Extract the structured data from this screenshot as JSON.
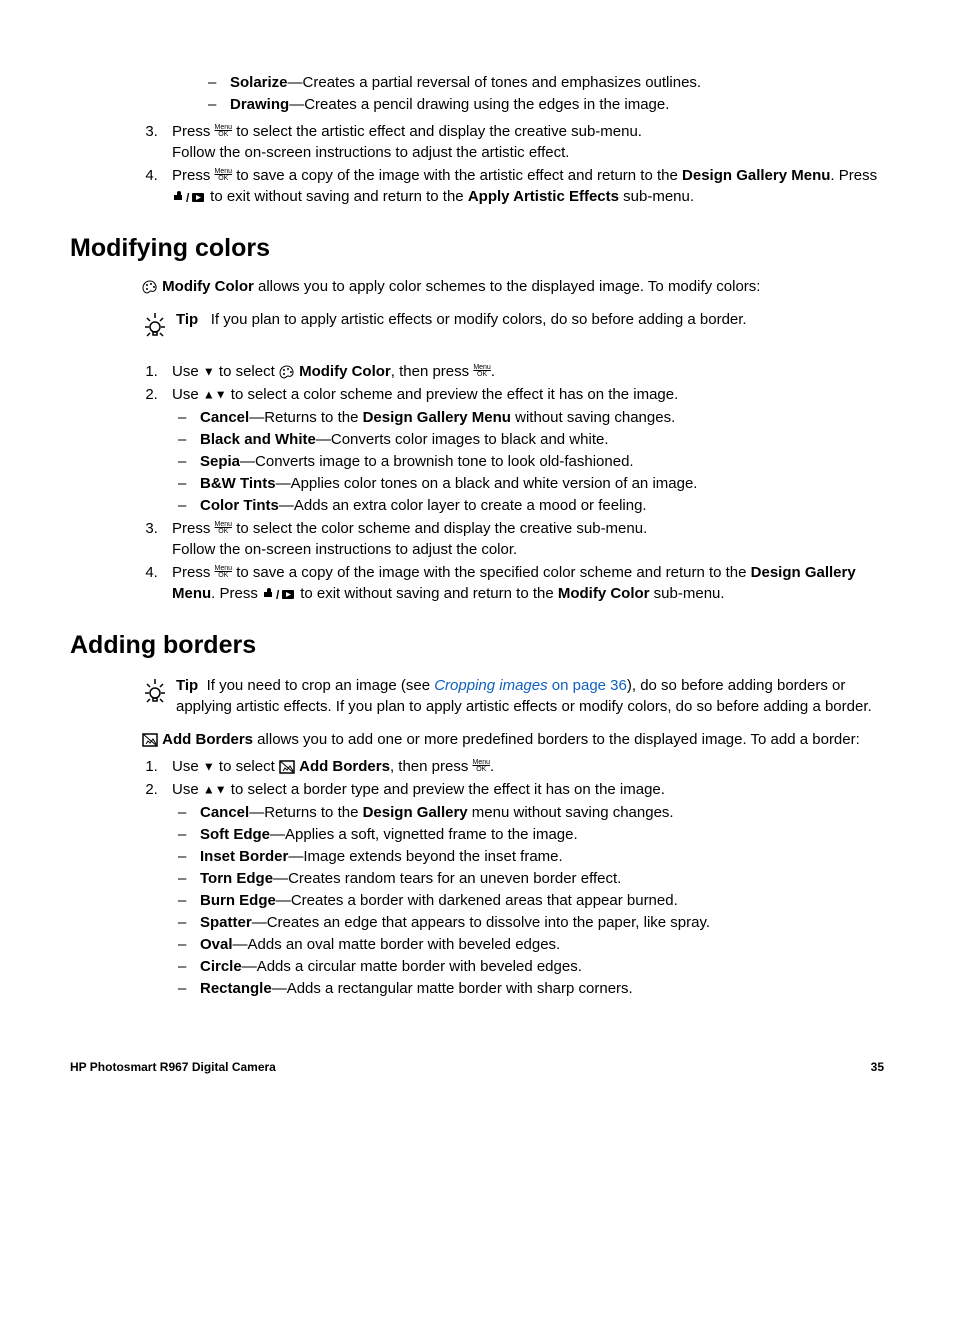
{
  "top_list": {
    "sub_items": [
      {
        "name": "Solarize",
        "desc": "—Creates a partial reversal of tones and emphasizes outlines."
      },
      {
        "name": "Drawing",
        "desc": "—Creates a pencil drawing using the edges in the image."
      }
    ],
    "step3a": "Press ",
    "step3b": " to select the artistic effect and display the creative sub-menu.",
    "step3c": "Follow the on-screen instructions to adjust the artistic effect.",
    "step4a": "Press ",
    "step4b": " to save a copy of the image with the artistic effect and return to the ",
    "step4_design": "Design Gallery Menu",
    "step4c": ". Press ",
    "step4d": " to exit without saving and return to the ",
    "step4_apply": "Apply Artistic Effects",
    "step4e": " sub-menu."
  },
  "modifying_colors": {
    "heading": "Modifying colors",
    "intro_bold": "Modify Color",
    "intro_rest": " allows you to apply color schemes to the displayed image. To modify colors:",
    "tip_label": "Tip",
    "tip_text": "If you plan to apply artistic effects or modify colors, do so before adding a border.",
    "step1a": "Use ",
    "step1b": " to select ",
    "step1_bold": "Modify Color",
    "step1c": ", then press ",
    "step1d": ".",
    "step2": "Use ",
    "step2b": " to select a color scheme and preview the effect it has on the image.",
    "schemes": [
      {
        "name": "Cancel",
        "desc_a": "—Returns to the ",
        "desc_bold": "Design Gallery Menu",
        "desc_b": " without saving changes."
      },
      {
        "name": "Black and White",
        "desc_a": "—Converts color images to black and white.",
        "desc_bold": "",
        "desc_b": ""
      },
      {
        "name": "Sepia",
        "desc_a": "—Converts image to a brownish tone to look old-fashioned.",
        "desc_bold": "",
        "desc_b": ""
      },
      {
        "name": "B&W Tints",
        "desc_a": "—Applies color tones on a black and white version of an image.",
        "desc_bold": "",
        "desc_b": ""
      },
      {
        "name": "Color Tints",
        "desc_a": "—Adds an extra color layer to create a mood or feeling.",
        "desc_bold": "",
        "desc_b": ""
      }
    ],
    "step3a": "Press ",
    "step3b": " to select the color scheme and display the creative sub-menu.",
    "step3c": "Follow the on-screen instructions to adjust the color.",
    "step4a": "Press ",
    "step4b": " to save a copy of the image with the specified color scheme and return to the ",
    "step4_design": "Design Gallery Menu",
    "step4c": ". Press ",
    "step4d": " to exit without saving and return to the ",
    "step4_modify": "Modify Color",
    "step4e": " sub-menu."
  },
  "adding_borders": {
    "heading": "Adding borders",
    "tip_label": "Tip",
    "tip_a": "If you need to crop an image (see ",
    "tip_link": "Cropping images",
    "tip_link2": " on page 36",
    "tip_b": "), do so before adding borders or applying artistic effects. If you plan to apply artistic effects or modify colors, do so before adding a border.",
    "intro_bold": "Add Borders",
    "intro_rest": " allows you to add one or more predefined borders to the displayed image. To add a border:",
    "step1a": "Use ",
    "step1b": " to select ",
    "step1_bold": "Add Borders",
    "step1c": ", then press ",
    "step1d": ".",
    "step2a": "Use ",
    "step2b": " to select a border type and preview the effect it has on the image.",
    "borders": [
      {
        "name": "Cancel",
        "desc_a": "—Returns to the ",
        "desc_bold": "Design Gallery",
        "desc_b": " menu without saving changes."
      },
      {
        "name": "Soft Edge",
        "desc_a": "—Applies a soft, vignetted frame to the image.",
        "desc_bold": "",
        "desc_b": ""
      },
      {
        "name": "Inset Border",
        "desc_a": "—Image extends beyond the inset frame.",
        "desc_bold": "",
        "desc_b": ""
      },
      {
        "name": "Torn Edge",
        "desc_a": "—Creates random tears for an uneven border effect.",
        "desc_bold": "",
        "desc_b": ""
      },
      {
        "name": "Burn Edge",
        "desc_a": "—Creates a border with darkened areas that appear burned.",
        "desc_bold": "",
        "desc_b": ""
      },
      {
        "name": "Spatter",
        "desc_a": "—Creates an edge that appears to dissolve into the paper, like spray.",
        "desc_bold": "",
        "desc_b": ""
      },
      {
        "name": "Oval",
        "desc_a": "—Adds an oval matte border with beveled edges.",
        "desc_bold": "",
        "desc_b": ""
      },
      {
        "name": "Circle",
        "desc_a": "—Adds a circular matte border with beveled edges.",
        "desc_bold": "",
        "desc_b": ""
      },
      {
        "name": "Rectangle",
        "desc_a": "—Adds a rectangular matte border with sharp corners.",
        "desc_bold": "",
        "desc_b": ""
      }
    ]
  },
  "footer": {
    "left": "HP Photosmart R967 Digital Camera",
    "right": "35"
  }
}
